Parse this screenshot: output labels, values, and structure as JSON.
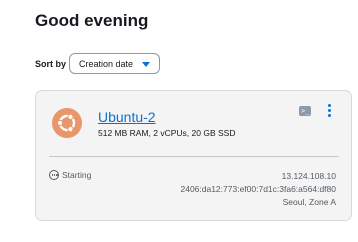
{
  "header": {
    "greeting": "Good evening"
  },
  "sort": {
    "label": "Sort by",
    "selected": "Creation date"
  },
  "instance": {
    "name": "Ubuntu-2",
    "specs": "512 MB RAM, 2 vCPUs, 20 GB SSD",
    "os_icon": "ubuntu-logo-icon",
    "os_color": "#e9966a",
    "status": "Starting",
    "ipv4": "13.124.108.10",
    "ipv6": "2406:da12:773:ef00:7d1c:3fa6:a564:df80",
    "location": "Seoul, Zone A",
    "connect_icon": "terminal-icon",
    "menu_icon": "kebab-menu-icon"
  },
  "colors": {
    "link": "#0972d3",
    "text": "#16191f",
    "muted": "#545b64",
    "card_bg": "#f4f4f4"
  }
}
